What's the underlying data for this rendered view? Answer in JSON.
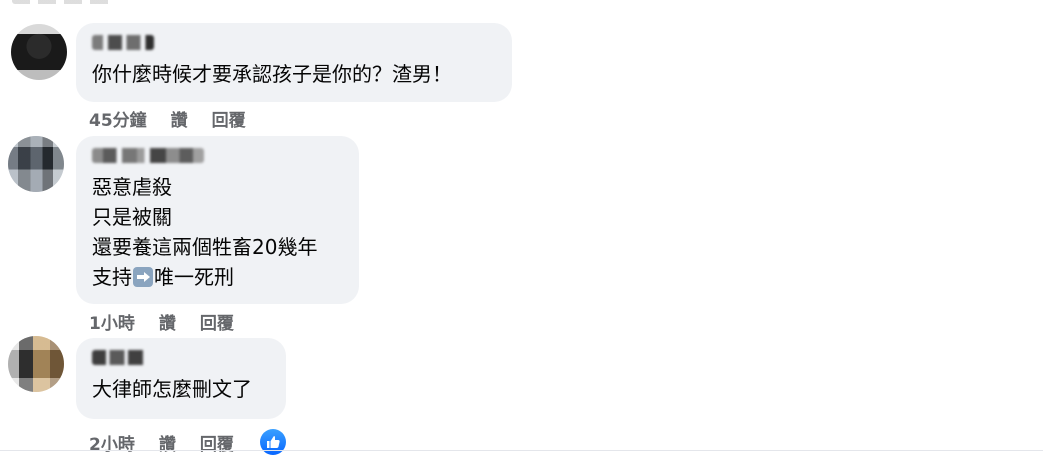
{
  "comments": [
    {
      "text_lines": [
        "你什麼時候才要承認孩子是你的？渣男！"
      ],
      "time": "45分鐘",
      "like_label": "讚",
      "reply_label": "回覆"
    },
    {
      "text_lines": [
        "惡意虐殺",
        "只是被關",
        "還要養這兩個牲畜20幾年",
        "支持",
        "唯一死刑"
      ],
      "time": "1小時",
      "like_label": "讚",
      "reply_label": "回覆"
    },
    {
      "text_lines": [
        "大律師怎麼刪文了"
      ],
      "time": "2小時",
      "like_label": "讚",
      "reply_label": "回覆",
      "reaction": "like-icon"
    }
  ],
  "colors": {
    "bubble": "#f0f2f5",
    "meta_text": "#65676b",
    "like_badge": "#0866ff"
  }
}
